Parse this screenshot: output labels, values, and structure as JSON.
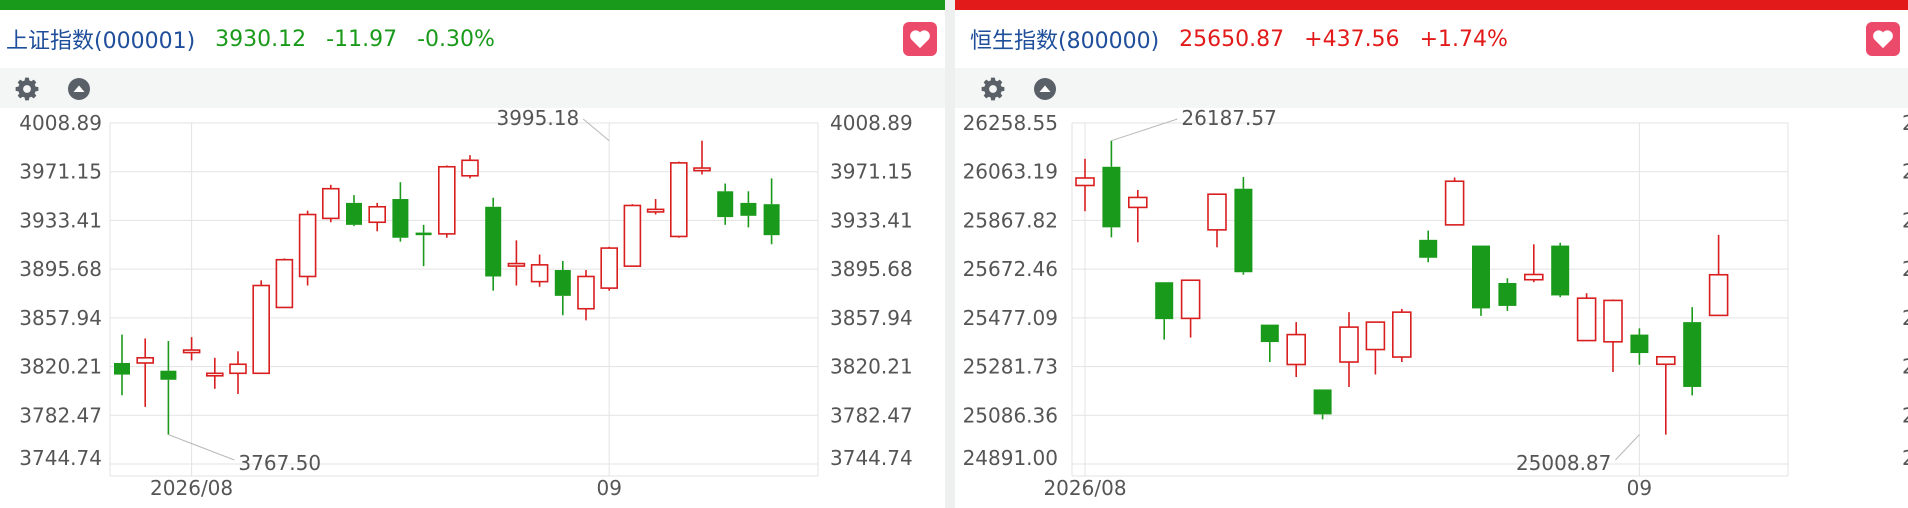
{
  "colors": {
    "up": "#d81e1e",
    "down": "#1a9a1a",
    "name": "#1f4e9a",
    "grid": "#e3e3e3",
    "axis_text": "#555555",
    "annotation": "#555555"
  },
  "icons": [
    "gear-icon",
    "collapse-up-icon",
    "heart-icon"
  ],
  "panels": [
    {
      "name": "上证指数(000001)",
      "price": "3930.12",
      "change": "-11.97",
      "change_pct": "-0.30%",
      "direction": "down",
      "accent": "#1a9a1a"
    },
    {
      "name": "恒生指数(800000)",
      "price": "25650.87",
      "change": "+437.56",
      "change_pct": "+1.74%",
      "direction": "up",
      "accent": "#e21a1a"
    }
  ],
  "chart_data": [
    {
      "type": "candlestick",
      "title": "上证指数(000001)",
      "y_ticks": [
        "4008.89",
        "3971.15",
        "3933.41",
        "3895.68",
        "3857.94",
        "3820.21",
        "3782.47",
        "3744.74"
      ],
      "ylim": [
        3744.74,
        4008.89
      ],
      "x_tick_labels": [
        {
          "label": "2026/08",
          "at_index": 3
        },
        {
          "label": "09",
          "at_index": 21
        }
      ],
      "annotations": [
        {
          "label": "3995.18",
          "at_index": 21,
          "value": 3995.18,
          "kind": "high"
        },
        {
          "label": "3767.50",
          "at_index": 2,
          "value": 3767.5,
          "kind": "low"
        }
      ],
      "candles": [
        {
          "o": 3823,
          "h": 3845,
          "l": 3798,
          "c": 3814
        },
        {
          "o": 3823,
          "h": 3842,
          "l": 3789,
          "c": 3827
        },
        {
          "o": 3817,
          "h": 3840,
          "l": 3767.5,
          "c": 3810
        },
        {
          "o": 3833,
          "h": 3843,
          "l": 3825,
          "c": 3833
        },
        {
          "o": 3815,
          "h": 3827,
          "l": 3803,
          "c": 3815
        },
        {
          "o": 3815,
          "h": 3832,
          "l": 3799,
          "c": 3822
        },
        {
          "o": 3815,
          "h": 3887,
          "l": 3815,
          "c": 3883
        },
        {
          "o": 3866,
          "h": 3904,
          "l": 3866,
          "c": 3903
        },
        {
          "o": 3890,
          "h": 3941,
          "l": 3883,
          "c": 3938
        },
        {
          "o": 3935,
          "h": 3961,
          "l": 3932,
          "c": 3958
        },
        {
          "o": 3947,
          "h": 3953,
          "l": 3929,
          "c": 3930
        },
        {
          "o": 3932,
          "h": 3947,
          "l": 3925,
          "c": 3944
        },
        {
          "o": 3950,
          "h": 3963,
          "l": 3917,
          "c": 3920
        },
        {
          "o": 3924,
          "h": 3930,
          "l": 3898,
          "c": 3922
        },
        {
          "o": 3923,
          "h": 3976,
          "l": 3920,
          "c": 3975
        },
        {
          "o": 3968,
          "h": 3984,
          "l": 3966,
          "c": 3980
        },
        {
          "o": 3944,
          "h": 3951,
          "l": 3879,
          "c": 3890
        },
        {
          "o": 3900,
          "h": 3918,
          "l": 3883,
          "c": 3900
        },
        {
          "o": 3886,
          "h": 3907,
          "l": 3882,
          "c": 3899
        },
        {
          "o": 3895,
          "h": 3902,
          "l": 3860,
          "c": 3875
        },
        {
          "o": 3865,
          "h": 3895,
          "l": 3856,
          "c": 3890
        },
        {
          "o": 3881,
          "h": 3913,
          "l": 3879,
          "c": 3912
        },
        {
          "o": 3898,
          "h": 3946,
          "l": 3898,
          "c": 3945
        },
        {
          "o": 3940,
          "h": 3950,
          "l": 3938,
          "c": 3942
        },
        {
          "o": 3921,
          "h": 3979,
          "l": 3920,
          "c": 3978
        },
        {
          "o": 3972,
          "h": 3995.18,
          "l": 3969,
          "c": 3974
        },
        {
          "o": 3956,
          "h": 3962,
          "l": 3930,
          "c": 3936
        },
        {
          "o": 3947,
          "h": 3956,
          "l": 3928,
          "c": 3937
        },
        {
          "o": 3946,
          "h": 3966,
          "l": 3915,
          "c": 3922
        }
      ]
    },
    {
      "type": "candlestick",
      "title": "恒生指数(800000)",
      "y_ticks": [
        "26258.55",
        "26063.19",
        "25867.82",
        "25672.46",
        "25477.09",
        "25281.73",
        "25086.36",
        "24891.00"
      ],
      "ylim": [
        24891.0,
        26258.55
      ],
      "x_tick_labels": [
        {
          "label": "2026/08",
          "at_index": 0
        },
        {
          "label": "09",
          "at_index": 21
        }
      ],
      "annotations": [
        {
          "label": "26187.57",
          "at_index": 1,
          "value": 26187.57,
          "kind": "high"
        },
        {
          "label": "25008.87",
          "at_index": 21,
          "value": 25008.87,
          "kind": "low"
        }
      ],
      "candles": [
        {
          "o": 26008,
          "h": 26115,
          "l": 25905,
          "c": 26038
        },
        {
          "o": 26083,
          "h": 26187.57,
          "l": 25800,
          "c": 25840
        },
        {
          "o": 25920,
          "h": 25990,
          "l": 25780,
          "c": 25960
        },
        {
          "o": 25620,
          "h": 25620,
          "l": 25390,
          "c": 25472
        },
        {
          "o": 25475,
          "h": 25628,
          "l": 25398,
          "c": 25628
        },
        {
          "o": 25830,
          "h": 25960,
          "l": 25760,
          "c": 25973
        },
        {
          "o": 25995,
          "h": 26042,
          "l": 25650,
          "c": 25660
        },
        {
          "o": 25450,
          "h": 25450,
          "l": 25300,
          "c": 25380
        },
        {
          "o": 25290,
          "h": 25460,
          "l": 25240,
          "c": 25410
        },
        {
          "o": 25190,
          "h": 25190,
          "l": 25070,
          "c": 25090
        },
        {
          "o": 25300,
          "h": 25500,
          "l": 25200,
          "c": 25440
        },
        {
          "o": 25350,
          "h": 25460,
          "l": 25250,
          "c": 25460
        },
        {
          "o": 25320,
          "h": 25513,
          "l": 25300,
          "c": 25500
        },
        {
          "o": 25790,
          "h": 25827,
          "l": 25700,
          "c": 25718
        },
        {
          "o": 25850,
          "h": 26040,
          "l": 25850,
          "c": 26025
        },
        {
          "o": 25767,
          "h": 25767,
          "l": 25485,
          "c": 25515
        },
        {
          "o": 25617,
          "h": 25636,
          "l": 25505,
          "c": 25525
        },
        {
          "o": 25630,
          "h": 25772,
          "l": 25620,
          "c": 25651
        },
        {
          "o": 25767,
          "h": 25778,
          "l": 25560,
          "c": 25567
        },
        {
          "o": 25386,
          "h": 25576,
          "l": 25386,
          "c": 25556
        },
        {
          "o": 25381,
          "h": 25551,
          "l": 25260,
          "c": 25547
        },
        {
          "o": 25410,
          "h": 25435,
          "l": 25289,
          "c": 25336
        },
        {
          "o": 25291,
          "h": 25320,
          "l": 25008.87,
          "c": 25321
        },
        {
          "o": 25460,
          "h": 25520,
          "l": 25166,
          "c": 25200
        },
        {
          "o": 25487,
          "h": 25810,
          "l": 25487,
          "c": 25650
        }
      ]
    }
  ]
}
